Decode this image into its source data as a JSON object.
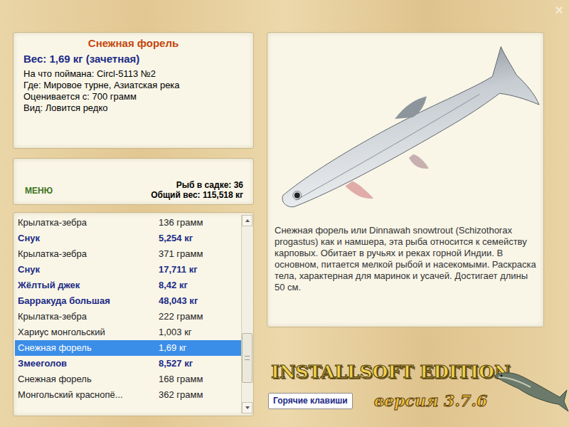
{
  "window": {
    "close": "×"
  },
  "fish_info": {
    "title": "Снежная форель",
    "weight": "Вес: 1,69 кг (зачетная)",
    "lines": [
      "На что поймана: Circl-5113 №2",
      "Где: Мировое турне, Азиатская река",
      "Оценивается с: 700 грамм",
      "Вид: Ловится редко"
    ]
  },
  "menu": {
    "label": "МЕНЮ",
    "count": "Рыб в садке: 36",
    "total": "Общий вес: 115,518 кг"
  },
  "catch_list": {
    "rows": [
      {
        "name": "Крылатка-зебра",
        "weight": "136 грамм",
        "trophy": false,
        "selected": false
      },
      {
        "name": "Снук",
        "weight": "5,254 кг",
        "trophy": true,
        "selected": false
      },
      {
        "name": "Крылатка-зебра",
        "weight": "371 грамм",
        "trophy": false,
        "selected": false
      },
      {
        "name": "Снук",
        "weight": "17,711 кг",
        "trophy": true,
        "selected": false
      },
      {
        "name": "Жёлтый джек",
        "weight": "8,42 кг",
        "trophy": true,
        "selected": false
      },
      {
        "name": "Барракуда большая",
        "weight": "48,043 кг",
        "trophy": true,
        "selected": false
      },
      {
        "name": "Крылатка-зебра",
        "weight": "222 грамм",
        "trophy": false,
        "selected": false
      },
      {
        "name": "Хариус монгольский",
        "weight": "1,003 кг",
        "trophy": false,
        "selected": false
      },
      {
        "name": "Снежная форель",
        "weight": "1,69 кг",
        "trophy": true,
        "selected": true
      },
      {
        "name": "Змееголов",
        "weight": "8,527 кг",
        "trophy": true,
        "selected": false
      },
      {
        "name": "Снежная форель",
        "weight": "168 грамм",
        "trophy": false,
        "selected": false
      },
      {
        "name": "Монгольский краснопё...",
        "weight": "362 грамм",
        "trophy": false,
        "selected": false
      }
    ],
    "scrollbar": {
      "position": 0.85
    }
  },
  "description": "Снежная форель или Dinnawah snowtrout (Schizothorax progastus) как и намшера, эта рыба относится к семейству карповых. Обитает в ручьях и реках горной Индии. В основном, питается мелкой рыбой и насекомыми. Раскраска тела, характерная для маринок и усачей. Достигает длины 50 см.",
  "logo": {
    "title": "INSTALLSOFT EDITION",
    "version": "версия 3.7.6"
  },
  "hotkeys_button": "Горячие клавиши"
}
